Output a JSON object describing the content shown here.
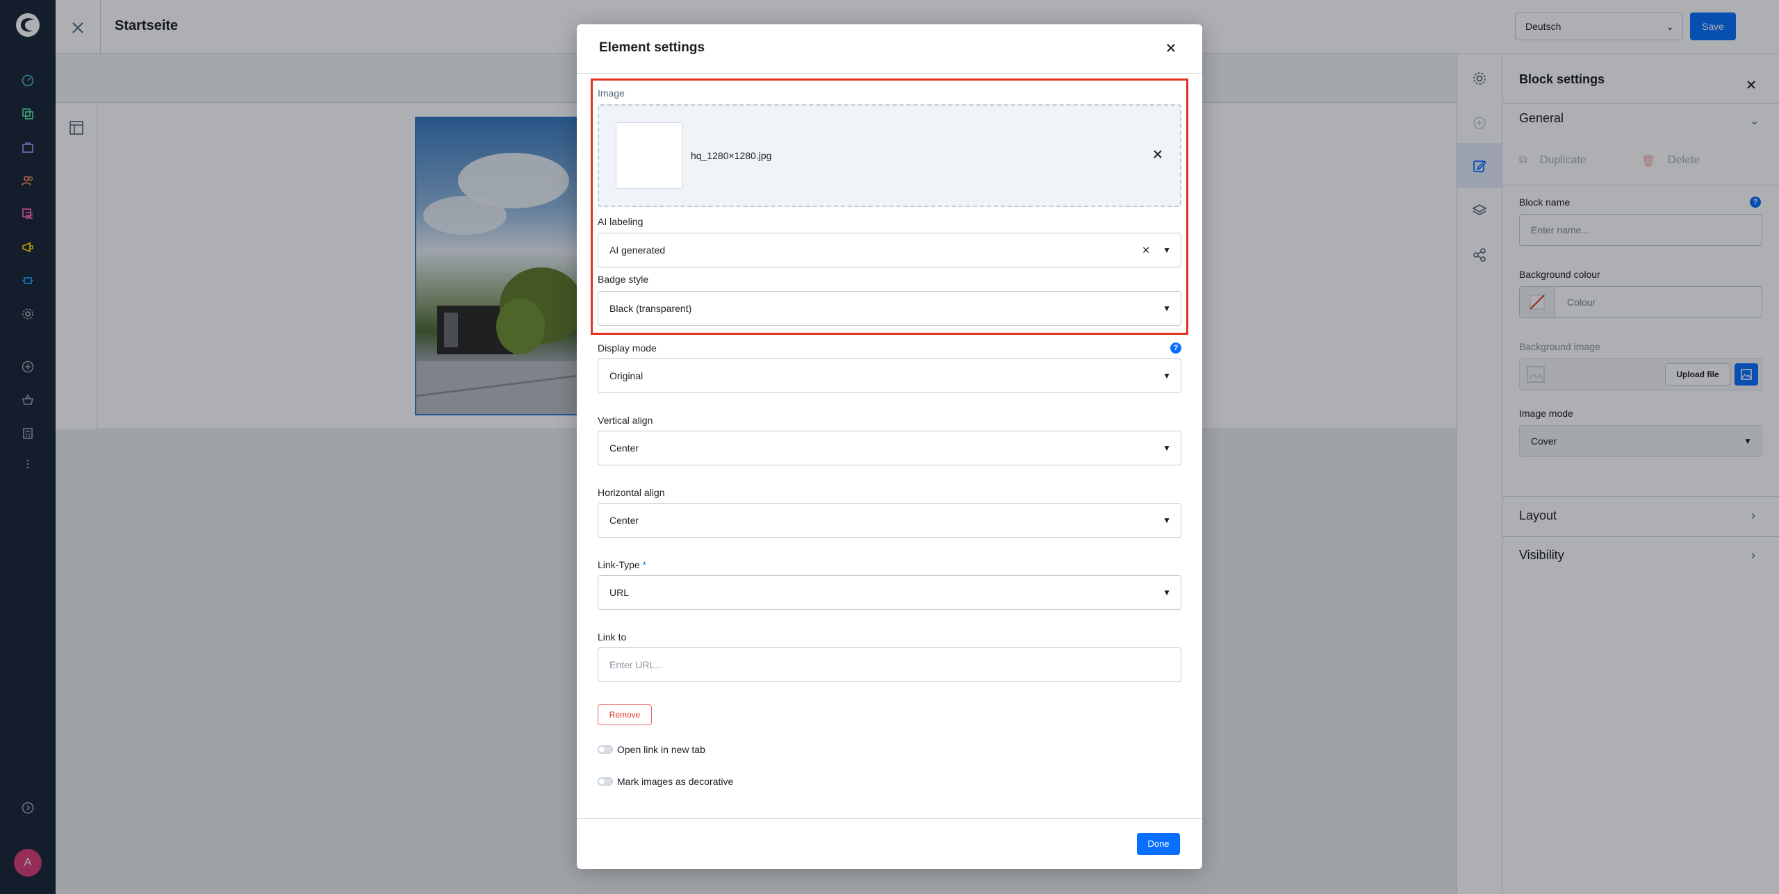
{
  "header": {
    "page_title": "Startseite",
    "language": "Deutsch",
    "save_label": "Save"
  },
  "user": {
    "avatar_initial": "A"
  },
  "modal": {
    "title": "Element settings",
    "image_label": "Image",
    "file_name": "hq_1280×1280.jpg",
    "ai_labeling_label": "AI labeling",
    "ai_labeling_value": "AI generated",
    "badge_style_label": "Badge style",
    "badge_style_value": "Black (transparent)",
    "display_mode_label": "Display mode",
    "display_mode_value": "Original",
    "vertical_align_label": "Vertical align",
    "vertical_align_value": "Center",
    "horizontal_align_label": "Horizontal align",
    "horizontal_align_value": "Center",
    "link_type_label": "Link-Type",
    "link_type_required": "*",
    "link_type_value": "URL",
    "link_to_label": "Link to",
    "link_to_placeholder": "Enter URL...",
    "remove_label": "Remove",
    "open_new_tab_label": "Open link in new tab",
    "decorative_label": "Mark images as decorative",
    "done_label": "Done"
  },
  "sidebar": {
    "title": "Block settings",
    "general_label": "General",
    "duplicate_label": "Duplicate",
    "delete_label": "Delete",
    "block_name_label": "Block name",
    "block_name_placeholder": "Enter name...",
    "bg_colour_label": "Background colour",
    "bg_colour_placeholder": "Colour",
    "bg_image_label": "Background image",
    "upload_file_label": "Upload file",
    "image_mode_label": "Image mode",
    "image_mode_value": "Cover",
    "layout_label": "Layout",
    "visibility_label": "Visibility"
  },
  "colors": {
    "accent": "#0870ff",
    "highlight": "#e0321e",
    "nav_bg": "#1a2636"
  }
}
